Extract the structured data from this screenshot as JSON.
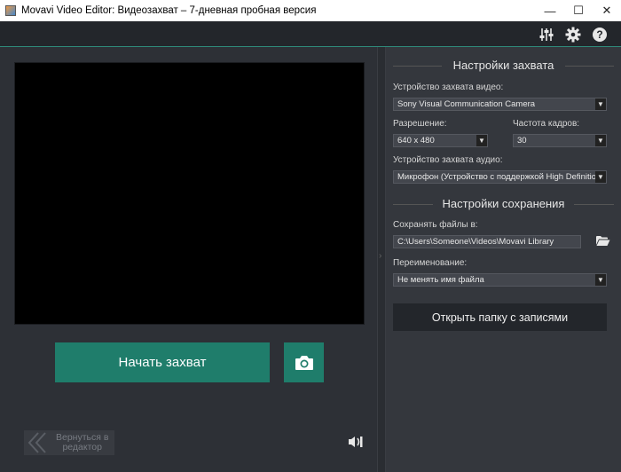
{
  "window": {
    "title": "Movavi Video Editor: Видеозахват – 7-дневная пробная версия",
    "minimize": "—",
    "maximize": "☐",
    "close": "✕"
  },
  "toolbar": {
    "icons": [
      "mixer-icon",
      "gear-icon",
      "help-icon"
    ],
    "help_glyph": "?"
  },
  "main": {
    "start_label": "Начать захват",
    "snapshot_icon": "camera-icon",
    "back_label_line1": "Вернуться в",
    "back_label_line2": "редактор",
    "volume_icon": "speaker-icon",
    "collapse_glyph": "›"
  },
  "capture_settings": {
    "title": "Настройки захвата",
    "video_device_label": "Устройство захвата видео:",
    "video_device_value": "Sony Visual Communication Camera",
    "resolution_label": "Разрешение:",
    "resolution_value": "640 x 480",
    "fps_label": "Частота кадров:",
    "fps_value": "30",
    "audio_device_label": "Устройство захвата аудио:",
    "audio_device_value": "Микрофон (Устройство с поддержкой High Definitio"
  },
  "save_settings": {
    "title": "Настройки сохранения",
    "save_to_label": "Сохранять файлы в:",
    "save_to_value": "C:\\Users\\Someone\\Videos\\Movavi Library",
    "rename_label": "Переименование:",
    "rename_value": "Не менять имя файла",
    "open_folder_label": "Открыть папку с записями"
  },
  "colors": {
    "accent": "#1f7d6b",
    "panel": "#34373d",
    "background": "#2d3036"
  }
}
